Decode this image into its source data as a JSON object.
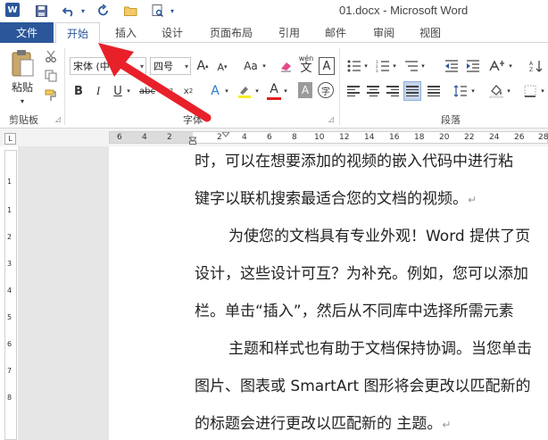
{
  "title_bar": {
    "app_icon_label": "W",
    "document_title": "01.docx - Microsoft Word"
  },
  "quick_access": {
    "save_icon": "save-icon",
    "undo_icon": "undo-icon",
    "redo_icon": "redo-icon",
    "open_icon": "folder-icon",
    "print_preview_icon": "print-preview-icon"
  },
  "tabs": {
    "file": "文件",
    "items": [
      "开始",
      "插入",
      "设计",
      "页面布局",
      "引用",
      "邮件",
      "审阅",
      "视图"
    ],
    "active": "开始"
  },
  "ribbon": {
    "clipboard": {
      "label": "剪贴板",
      "paste_label": "粘贴"
    },
    "font": {
      "label": "字体",
      "font_name": "宋体 (中",
      "font_size": "四号",
      "bold": "B",
      "italic": "I",
      "underline": "U",
      "strike": "abc",
      "grow": "A",
      "shrink": "A",
      "change_case": "Aa",
      "pinyin": "wén",
      "border_char": "A",
      "text_effect": "A",
      "font_color": "A",
      "shading": "A",
      "enclose": "字"
    },
    "paragraph": {
      "label": "段落"
    }
  },
  "ruler": {
    "corner": "L",
    "numbers_left": [
      "6",
      "4",
      "2"
    ],
    "numbers_right": [
      "2",
      "4",
      "6",
      "8",
      "10",
      "12",
      "14",
      "16",
      "18",
      "20",
      "22",
      "24",
      "26",
      "28"
    ],
    "vertical_numbers": [
      "1",
      "1",
      "2",
      "3",
      "4",
      "5",
      "6",
      "7",
      "8"
    ]
  },
  "document": {
    "lines": [
      "时，可以在想要添加的视频的嵌入代码中进行粘",
      "键字以联机搜索最适合您的文档的视频。",
      "为使您的文档具有专业外观！Word 提供了页",
      "设计，这些设计可互？为补充。例如，您可以添加",
      "栏。单击“插入”，然后从不同库中选择所需元素",
      "主题和样式也有助于文档保持协调。当您单击",
      "图片、图表或 SmartArt 图形将会更改以匹配新的",
      "的标题会进行更改以匹配新的 主题。"
    ],
    "paragraph_mark": "↵"
  },
  "colors": {
    "accent": "#2b579a",
    "annotation_arrow": "#e8202a"
  }
}
